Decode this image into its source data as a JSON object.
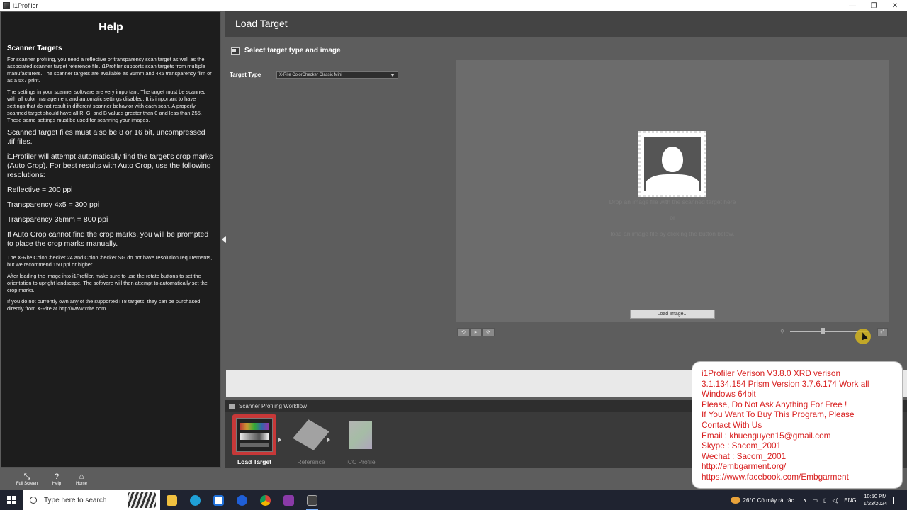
{
  "window": {
    "title": "i1Profiler",
    "controls": [
      "—",
      "❐",
      "✕"
    ]
  },
  "help": {
    "title": "Help",
    "subtitle": "Scanner Targets",
    "paragraphs": [
      {
        "size": "sm",
        "text": "For scanner profiling, you need a reflective or transparency scan target as well as the associated scanner target reference file. i1Profiler supports scan targets from multiple manufacturers. The scanner targets are available as 35mm and 4x5 transparency film or as a 5x7 print."
      },
      {
        "size": "sm",
        "text": "The settings in your scanner software are very important. The target must be scanned with all color management and automatic settings disabled. It is important to have settings that do not result in different scanner behavior with each scan. A properly scanned target should have all R, G, and B values greater than 0 and less than 255. These same settings must be used for scanning your images."
      },
      {
        "size": "lg",
        "text": "Scanned target files must also be 8 or 16 bit, uncompressed .tif files."
      },
      {
        "size": "lg",
        "text": "i1Profiler will attempt automatically find the target's crop marks (Auto Crop). For best results with Auto Crop, use the following resolutions:"
      },
      {
        "size": "lg",
        "text": "Reflective = 200 ppi"
      },
      {
        "size": "lg",
        "text": "Transparency 4x5 = 300 ppi"
      },
      {
        "size": "lg",
        "text": "Transparency 35mm = 800 ppi"
      },
      {
        "size": "lg",
        "text": "If Auto Crop cannot find the crop marks, you will be prompted to place the crop marks manually."
      },
      {
        "size": "sm",
        "text": "The X-Rite ColorChecker 24 and ColorChecker SG do not have resolution requirements, but we recommend 150 ppi or higher."
      },
      {
        "size": "sm",
        "text": "After loading the image into i1Profiler, make sure to use the rotate buttons to set the orientation to upright landscape. The software will then attempt to automatically set the crop marks."
      },
      {
        "size": "sm",
        "text": "If you do not currently own any of the supported IT8 targets, they can be purchased directly from X-Rite at http://www.xrite.com."
      }
    ]
  },
  "main": {
    "title": "Load Target",
    "section_title": "Select target type and image",
    "target_type_label": "Target Type",
    "target_type_value": "X-Rite ColorChecker Classic Mini",
    "drop_text_1": "Drop an image file with the scanned target here",
    "drop_or": "or",
    "drop_text_2": "load an image file by clicking the button below.",
    "load_button": "Load Image...",
    "rotate_buttons": [
      "⟲",
      "▸",
      "⟳"
    ],
    "fit_button": "⤢",
    "zoom_level": 0.42
  },
  "workflow": {
    "title": "Scanner Profiling Workflow",
    "steps": [
      {
        "label": "Load Target",
        "active": true
      },
      {
        "label": "Reference",
        "active": false
      },
      {
        "label": "ICC Profile",
        "active": false
      }
    ]
  },
  "bottom_tools": {
    "full_screen": "Full Screen",
    "help": "Help",
    "home": "Home"
  },
  "taskbar": {
    "search_placeholder": "Type here to search",
    "weather": "26°C  Có mây rải rác",
    "language": "ENG",
    "time": "10:50 PM",
    "date": "1/23/2024"
  },
  "promo": {
    "lines": [
      "i1Profiler Verison V3.8.0 XRD verison",
      "3.1.134.154 Prism Version 3.7.6.174 Work all",
      "Windows 64bit",
      "Please, Do Not Ask Anything For Free !",
      "If You Want To Buy This Program, Please",
      "Contact With Us",
      "Email : khuenguyen15@gmail.com",
      "Skype : Sacom_2001",
      "Wechat : Sacom_2001",
      "http://embgarment.org/",
      "https://www.facebook.com/Embgarment"
    ]
  },
  "colors": {
    "promo_text": "#d81f1f",
    "accent_active": "#c73838"
  }
}
